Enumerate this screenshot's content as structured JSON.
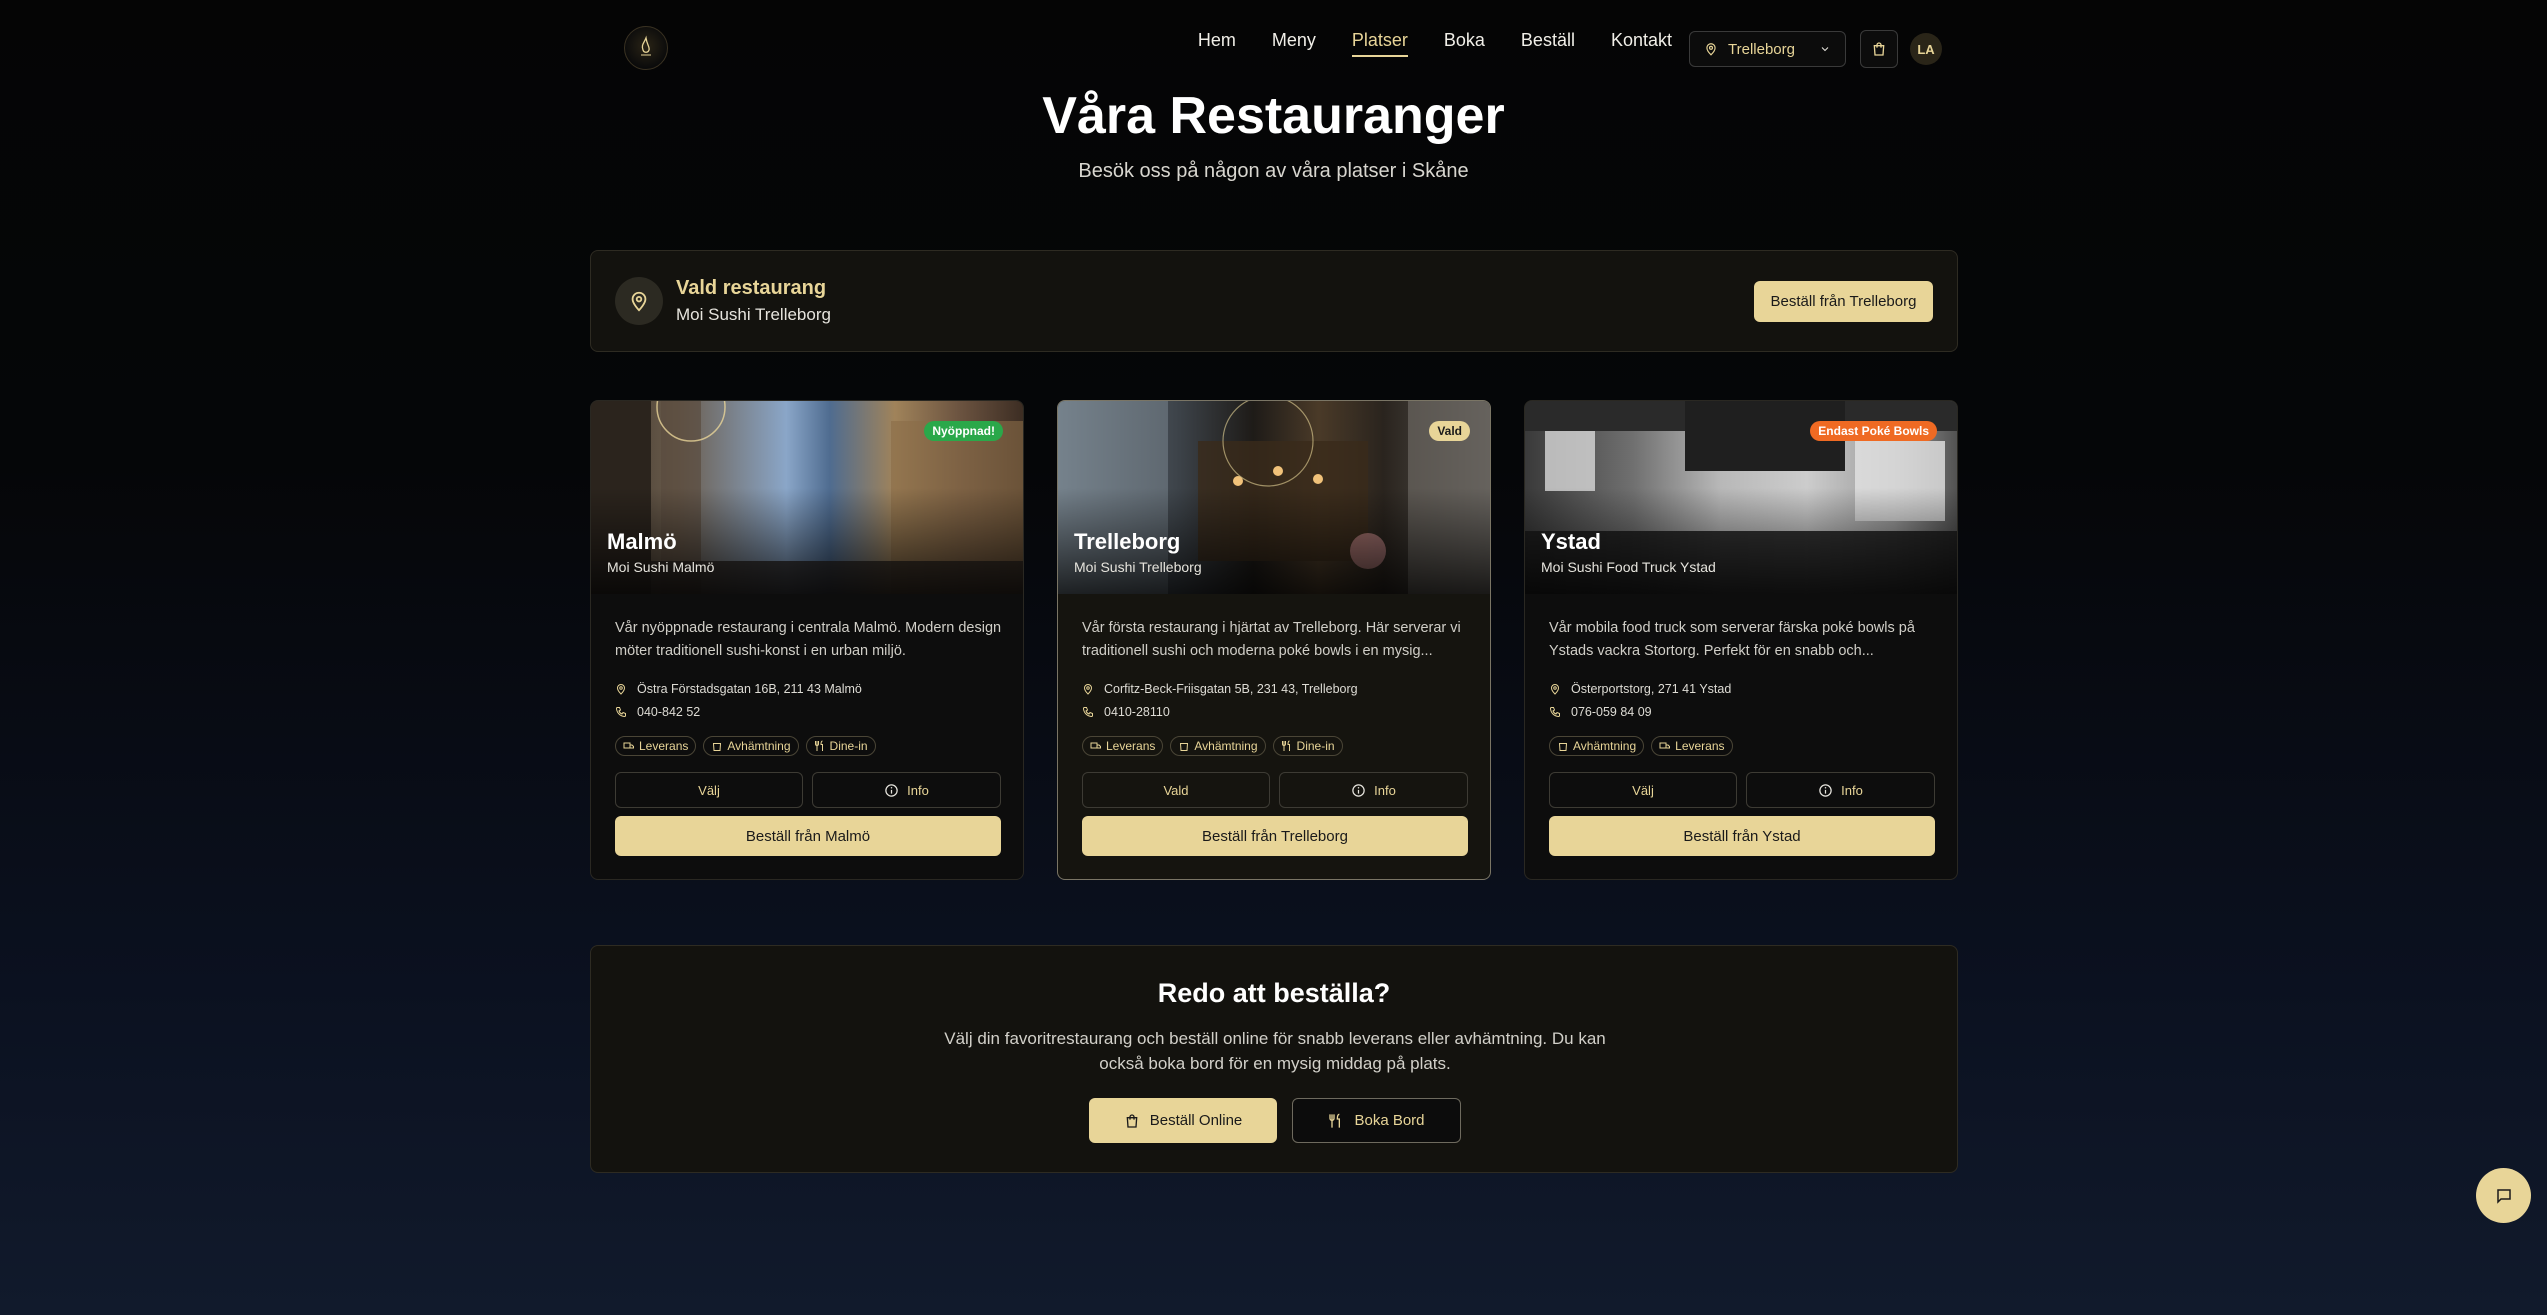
{
  "nav": {
    "links": [
      "Hem",
      "Meny",
      "Platser",
      "Boka",
      "Beställ",
      "Kontakt"
    ],
    "location_label": "Trelleborg",
    "avatar_initials": "LA"
  },
  "hero": {
    "title": "Våra Restauranger",
    "subtitle": "Besök oss på någon av våra platser i Skåne"
  },
  "selected": {
    "title": "Vald restaurang",
    "name": "Moi Sushi Trelleborg",
    "button_label": "Beställ från Trelleborg"
  },
  "cards": [
    {
      "badge": "Nyöppnad!",
      "city": "Malmö",
      "name": "Moi Sushi Malmö",
      "description": "Vår nyöppnade restaurang i centrala Malmö. Modern design möter traditionell sushi-konst i en urban miljö.",
      "address": "Östra Förstadsgatan 16B, 211 43 Malmö",
      "phone": "040-842 52",
      "tags": [
        "Leverans",
        "Avhämtning",
        "Dine-in"
      ],
      "choose_label": "Välj",
      "info_label": "Info",
      "order_label": "Beställ från Malmö"
    },
    {
      "badge": "Vald",
      "city": "Trelleborg",
      "name": "Moi Sushi Trelleborg",
      "description": "Vår första restaurang i hjärtat av Trelleborg. Här serverar vi traditionell sushi och moderna poké bowls i en mysig...",
      "address": "Corfitz-Beck-Friisgatan 5B, 231 43, Trelleborg",
      "phone": "0410-28110",
      "tags": [
        "Leverans",
        "Avhämtning",
        "Dine-in"
      ],
      "choose_label": "Vald",
      "info_label": "Info",
      "order_label": "Beställ från Trelleborg"
    },
    {
      "badge": "Endast Poké Bowls",
      "city": "Ystad",
      "name": "Moi Sushi Food Truck Ystad",
      "description": "Vår mobila food truck som serverar färska poké bowls på Ystads vackra Stortorg. Perfekt för en snabb och...",
      "address": "Österportstorg, 271 41 Ystad",
      "phone": "076-059 84 09",
      "tags": [
        "Avhämtning",
        "Leverans"
      ],
      "choose_label": "Välj",
      "info_label": "Info",
      "order_label": "Beställ från Ystad"
    }
  ],
  "cta": {
    "title": "Redo att beställa?",
    "text": "Välj din favoritrestaurang och beställ online för snabb leverans eller avhämtning. Du kan också boka bord för en mysig middag på plats.",
    "order_label": "Beställ Online",
    "book_label": "Boka Bord"
  },
  "colors": {
    "accent": "#e8d598",
    "badge_new": "#2aa84a",
    "badge_poke": "#ef6a23"
  }
}
